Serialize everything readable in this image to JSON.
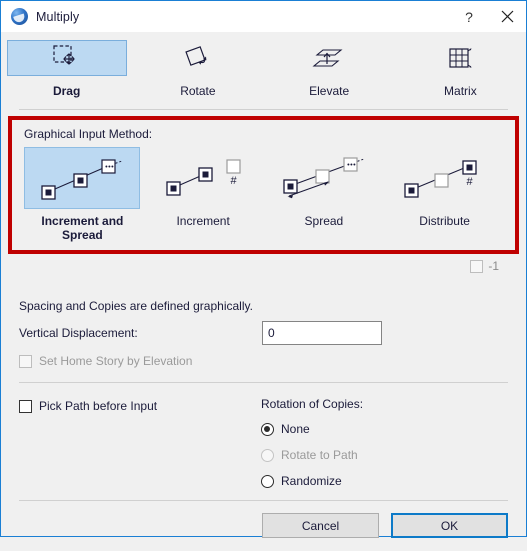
{
  "window": {
    "title": "Multiply",
    "help_label": "?",
    "close_label": "×"
  },
  "modes": [
    {
      "label": "Drag",
      "icon": "drag-icon",
      "selected": true
    },
    {
      "label": "Rotate",
      "icon": "rotate-icon",
      "selected": false
    },
    {
      "label": "Elevate",
      "icon": "elevate-icon",
      "selected": false
    },
    {
      "label": "Matrix",
      "icon": "matrix-icon",
      "selected": false
    }
  ],
  "graphical_input": {
    "group_label": "Graphical Input Method:",
    "highlight_color": "#bf0000",
    "selection_color": "#bcd9f2",
    "methods": [
      {
        "label": "Increment and Spread",
        "icon": "increment-and-spread-icon",
        "selected": true
      },
      {
        "label": "Increment",
        "icon": "increment-icon",
        "selected": false
      },
      {
        "label": "Spread",
        "icon": "spread-icon",
        "selected": false
      },
      {
        "label": "Distribute",
        "icon": "distribute-icon",
        "selected": false
      }
    ]
  },
  "minus_one": {
    "label": "-1",
    "checked": false,
    "disabled": true
  },
  "body": {
    "info_text": "Spacing and Copies are defined graphically.",
    "vertical_displacement": {
      "label": "Vertical Displacement:",
      "value": "0",
      "placeholder": ""
    },
    "set_home_story": {
      "label": "Set Home Story by Elevation",
      "checked": false,
      "disabled": true
    },
    "pick_path": {
      "label": "Pick Path before Input",
      "checked": false,
      "disabled": false
    },
    "rotation_of_copies": {
      "title": "Rotation of Copies:",
      "options": [
        {
          "label": "None",
          "selected": true,
          "disabled": false
        },
        {
          "label": "Rotate to Path",
          "selected": false,
          "disabled": true
        },
        {
          "label": "Randomize",
          "selected": false,
          "disabled": false
        }
      ]
    }
  },
  "footer": {
    "cancel_label": "Cancel",
    "ok_label": "OK",
    "default_button_color": "#0d7ac8"
  }
}
